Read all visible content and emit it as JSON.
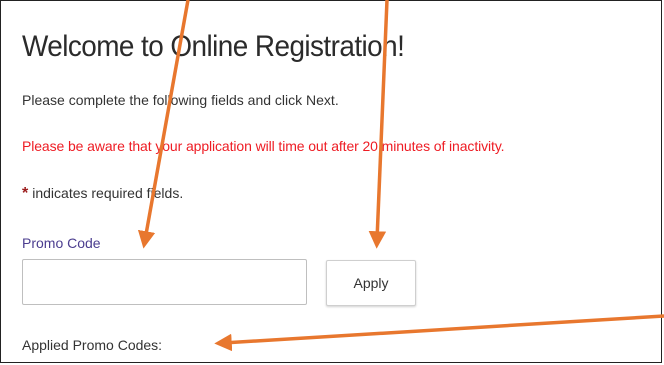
{
  "page": {
    "title": "Welcome to Online Registration!",
    "instructions": "Please complete the following fields and click Next.",
    "warning": "Please be aware that your application will time out after 20 minutes of inactivity.",
    "required_asterisk": "*",
    "required_note": "indicates required fields."
  },
  "promo": {
    "label": "Promo Code",
    "input_value": "",
    "apply_label": "Apply",
    "applied_label": "Applied Promo Codes:"
  },
  "colors": {
    "warning": "#ee1c24",
    "label_purple": "#4b3d8f",
    "asterisk": "#9b1b1b",
    "annotation_arrow": "#e8772e"
  }
}
